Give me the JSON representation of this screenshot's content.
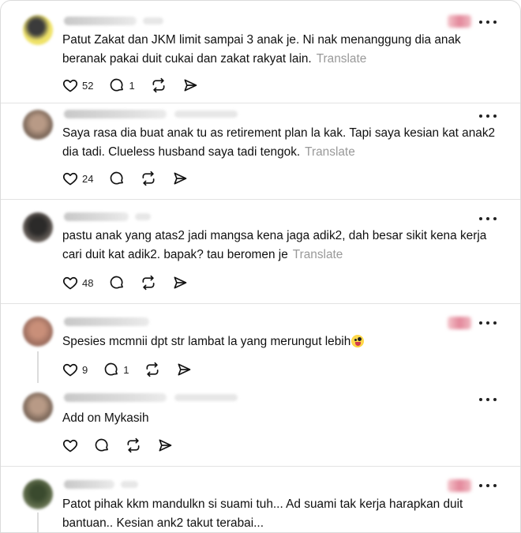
{
  "posts": [
    {
      "text": "Patut Zakat dan JKM limit sampai 3 anak je. Ni nak menanggung dia anak beranak pakai duit cukai dan zakat rakyat lain.",
      "translate": "Translate",
      "likes": "52",
      "replies": "1"
    },
    {
      "text": "Saya rasa dia buat anak tu as retirement plan la kak. Tapi saya kesian kat anak2 dia tadi. Clueless husband saya tadi tengok.",
      "translate": "Translate",
      "likes": "24",
      "replies": ""
    },
    {
      "text": "pastu anak yang atas2 jadi mangsa kena jaga adik2, dah besar sikit kena kerja cari duit kat adik2. bapak? tau beromen je",
      "translate": "Translate",
      "likes": "48",
      "replies": ""
    },
    {
      "text": "Spesies mcmnii dpt str lambat la yang merungut lebih",
      "translate": "",
      "likes": "9",
      "replies": "1"
    },
    {
      "text": "Add on Mykasih",
      "translate": "",
      "likes": "",
      "replies": ""
    },
    {
      "text": "Patot pihak kkm mandulkn si suami tuh... Ad suami tak kerja harapkan duit bantuan.. Kesian ank2 takut terabai...",
      "translate": "",
      "likes": "",
      "replies": ""
    }
  ],
  "icons": {
    "like": "heart-icon",
    "reply": "comment-icon",
    "repost": "repost-icon",
    "share": "send-icon",
    "more": "more-icon"
  },
  "colors": {
    "text": "#101010",
    "muted": "#999999",
    "divider": "#e3e3e3"
  }
}
